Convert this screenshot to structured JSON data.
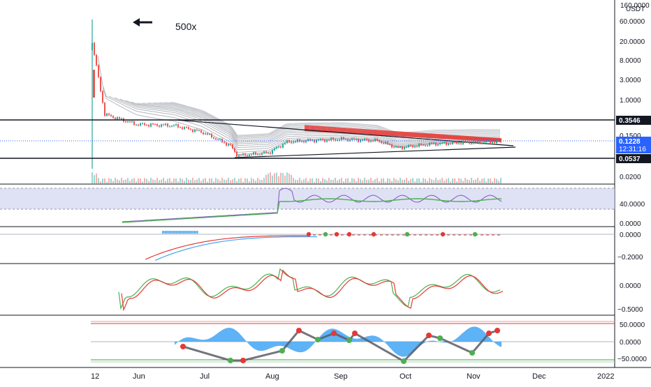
{
  "annotation": {
    "leverage_label": "500x",
    "arrow_icon": "left-arrow-icon"
  },
  "price_axis": {
    "unit_header": "160.0000",
    "unit": "USDT",
    "labels": [
      "60.0000",
      "20.0000",
      "8.0000",
      "3.0000",
      "1.0000",
      "0.1500",
      "0.0200"
    ]
  },
  "price_tags": {
    "upper_level": {
      "text": "0.3546",
      "color": "#131722"
    },
    "last_price": {
      "text": "0.1228",
      "color": "#2962ff"
    },
    "countdown": {
      "text": "12:31:16"
    },
    "lower_level": {
      "text": "0.0537",
      "color": "#131722"
    }
  },
  "panel_axes": {
    "rsi": [
      "40.0000",
      "0.0000"
    ],
    "macd": [
      "0.0000",
      "−0.2000"
    ],
    "oscillator": [
      "0.0000",
      "−0.5000"
    ],
    "momentum": [
      "50.0000",
      "0.0000",
      "−50.0000"
    ]
  },
  "time_axis": [
    "12",
    "Jun",
    "Jul",
    "Aug",
    "Sep",
    "Oct",
    "Nov",
    "Dec",
    "2022"
  ],
  "colors": {
    "candle_up": "#26a69a",
    "candle_down": "#ef5350",
    "resistance_line": "#e53935",
    "rsi_band": "#d1d4f0",
    "signal_green": "#4caf50",
    "signal_red": "#e53935",
    "momentum_fill": "#42a5f5"
  },
  "chart_data": {
    "type": "line",
    "x": [
      "May 12",
      "May 20",
      "Jun 1",
      "Jun 15",
      "Jul 1",
      "Jul 15",
      "Jul 20",
      "Aug 1",
      "Aug 5",
      "Aug 15",
      "Sep 1",
      "Sep 15",
      "Oct 1",
      "Oct 15",
      "Nov 1",
      "Nov 15"
    ],
    "series": [
      {
        "values": [
          20.0,
          0.5,
          0.3,
          0.28,
          0.2,
          0.1,
          0.06,
          0.07,
          0.12,
          0.13,
          0.14,
          0.13,
          0.09,
          0.11,
          0.12,
          0.1228
        ]
      }
    ],
    "ylim": [
      0.02,
      60
    ],
    "log_scale": true,
    "horizontal_levels": [
      0.3546,
      0.0537
    ],
    "last_price": 0.1228
  }
}
